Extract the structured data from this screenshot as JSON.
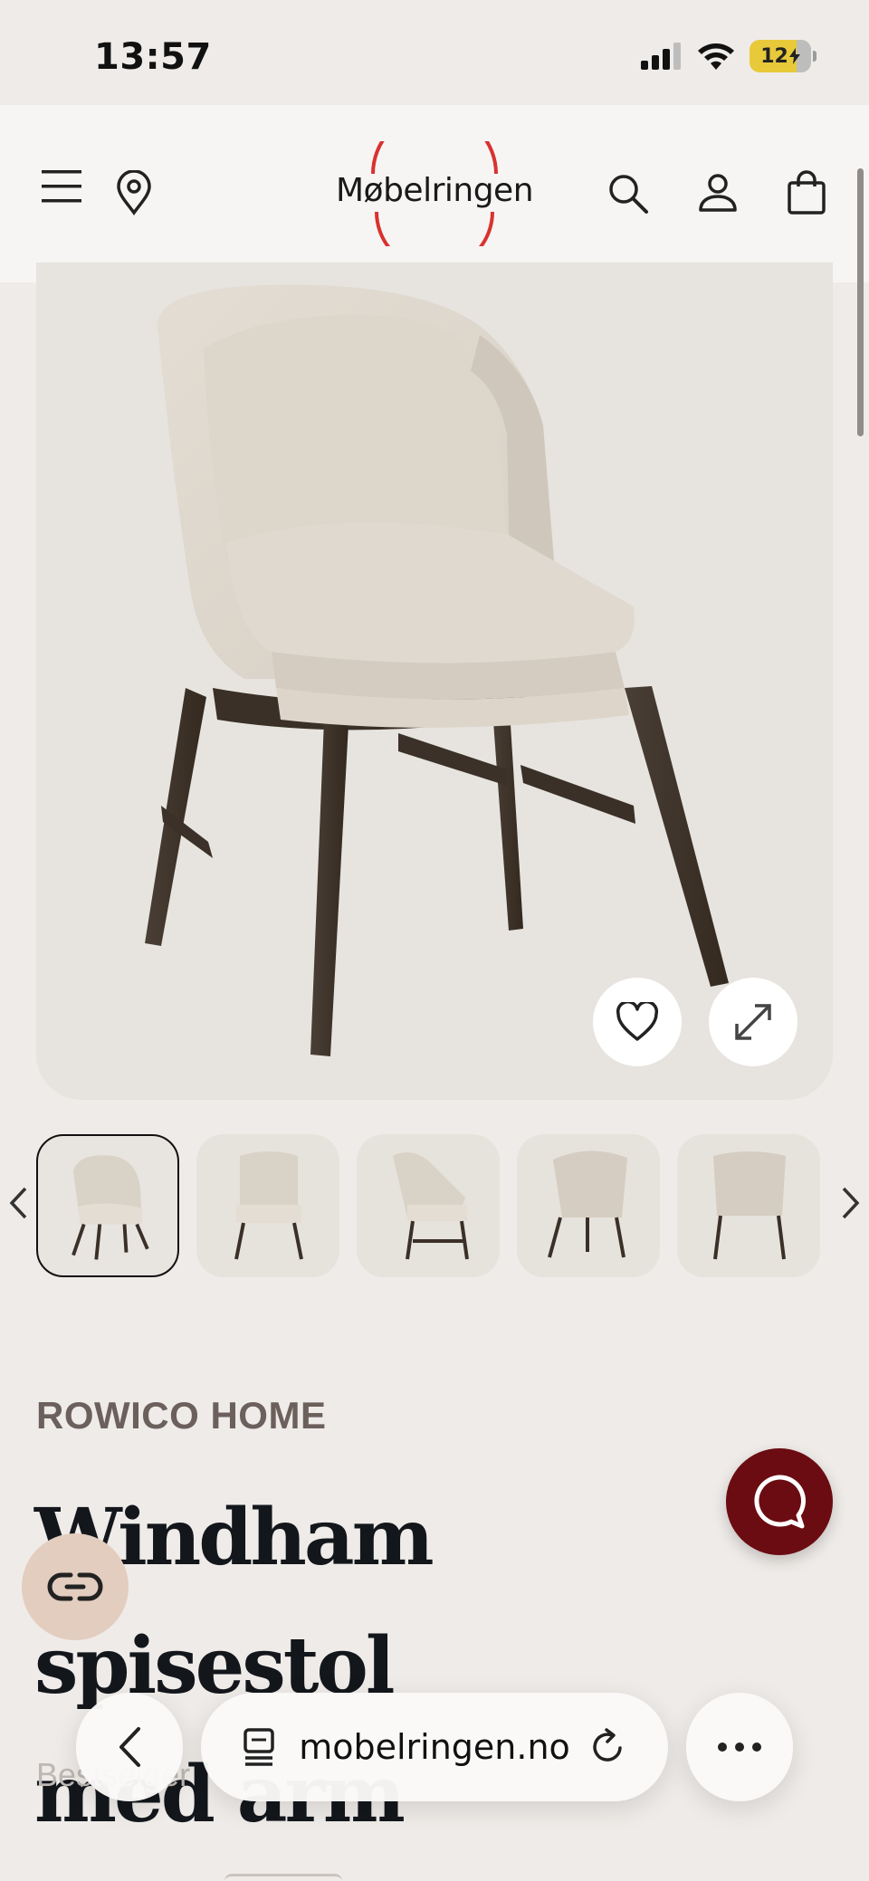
{
  "status_bar": {
    "time": "13:57",
    "battery": "12"
  },
  "header": {
    "logo": "Møbelringen"
  },
  "product": {
    "brand": "ROWICO HOME",
    "title_line1": "Windham spisestol",
    "title_line2": "med arm",
    "subtitle": "Bestselger"
  },
  "browser": {
    "url": "mobelringen.no"
  },
  "colors": {
    "accent": "#6b0c12",
    "logo_ring": "#d9322f",
    "page_bg": "#efebe8"
  },
  "thumbnails": [
    {
      "view": "front-angle",
      "selected": true
    },
    {
      "view": "front",
      "selected": false
    },
    {
      "view": "side",
      "selected": false
    },
    {
      "view": "back-angle",
      "selected": false
    },
    {
      "view": "back",
      "selected": false
    }
  ],
  "icons": {
    "menu": "menu-icon",
    "location": "location-pin-icon",
    "search": "search-icon",
    "account": "user-icon",
    "cart": "shopping-bag-icon",
    "favorite": "heart-icon",
    "expand": "expand-icon",
    "chat": "chat-icon",
    "link": "link-icon",
    "back": "chevron-left-icon",
    "reload": "reload-icon",
    "more": "more-icon"
  }
}
